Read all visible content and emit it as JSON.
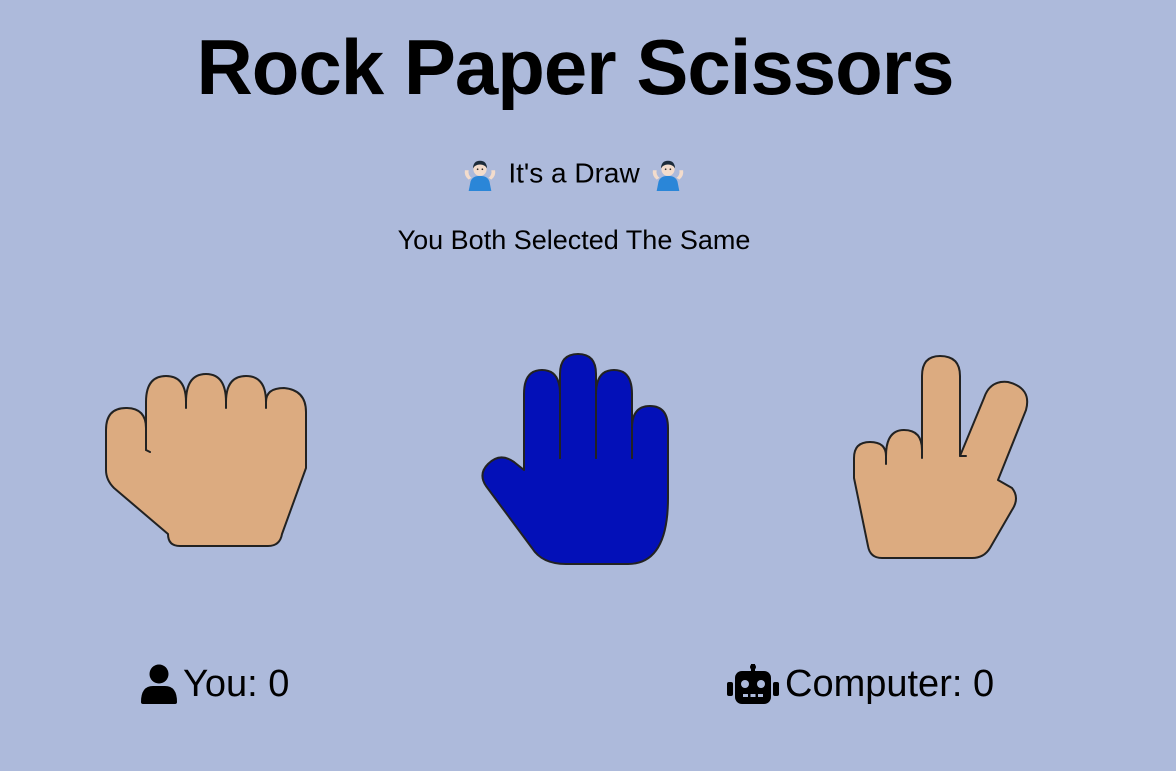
{
  "header": {
    "title": "Rock Paper Scissors"
  },
  "result": {
    "message": "It's a Draw",
    "emoji": "person-shrugging-emoji",
    "detail": "You Both Selected The Same"
  },
  "choices": [
    {
      "id": "rock",
      "icon": "hand-fist-icon",
      "color": "#dcab80",
      "selected": false
    },
    {
      "id": "paper",
      "icon": "hand-open-icon",
      "color": "#0310b8",
      "selected": true
    },
    {
      "id": "scissors",
      "icon": "hand-peace-icon",
      "color": "#dcab80",
      "selected": false
    }
  ],
  "scores": {
    "you_label": "You: 0",
    "computer_label": "Computer: 0",
    "you_icon": "user-icon",
    "computer_icon": "robot-icon"
  },
  "colors": {
    "background": "#adbadb",
    "hand_default": "#dcab80",
    "hand_selected": "#0310b8"
  }
}
